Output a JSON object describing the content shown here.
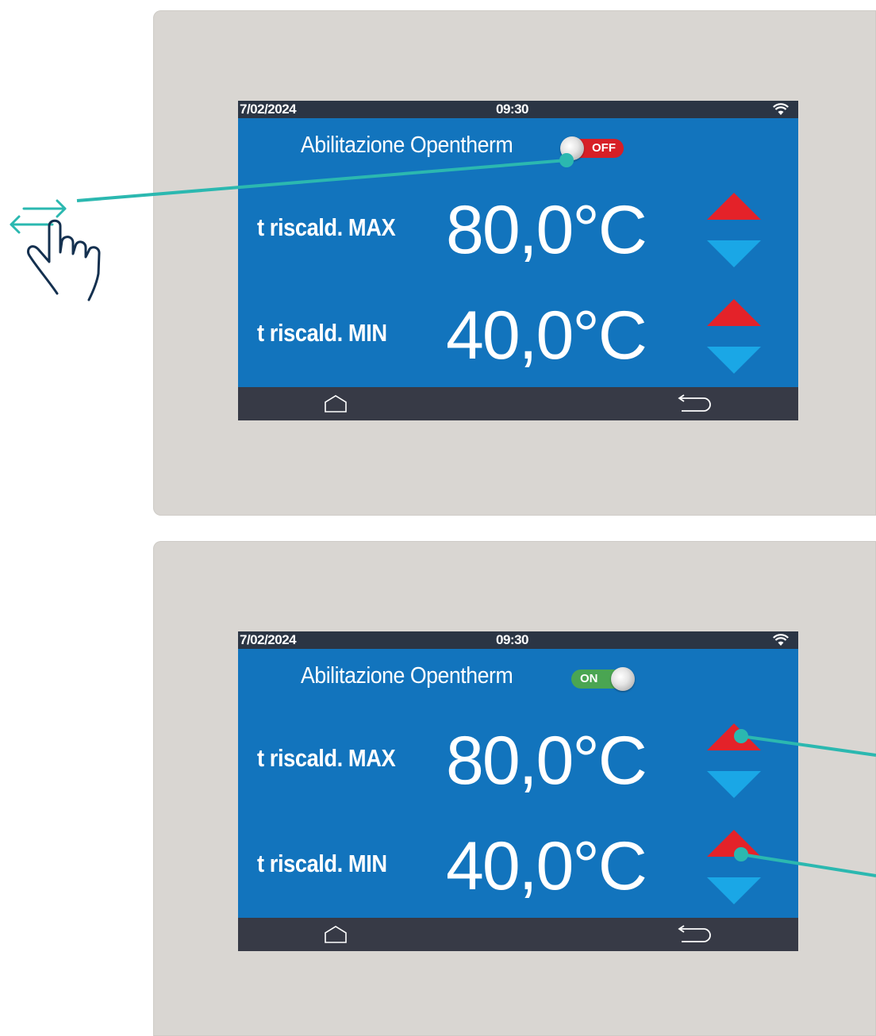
{
  "screens": [
    {
      "date": "7/02/2024",
      "time": "09:30",
      "opentherm_label": "Abilitazione Opentherm",
      "toggle_label": "OFF",
      "rows": [
        {
          "label": "t riscald. MAX",
          "value": "80,0°C"
        },
        {
          "label": "t riscald. MIN",
          "value": "40,0°C"
        }
      ]
    },
    {
      "date": "7/02/2024",
      "time": "09:30",
      "opentherm_label": "Abilitazione Opentherm",
      "toggle_label": "ON",
      "rows": [
        {
          "label": "t riscald. MAX",
          "value": "80,0°C"
        },
        {
          "label": "t riscald. MIN",
          "value": "40,0°C"
        }
      ]
    }
  ],
  "colors": {
    "screen_bg": "#1274bd",
    "status_bar": "#2b3544",
    "nav_bar": "#373a46",
    "up_arrow": "#e42229",
    "down_arrow": "#1aa7e6",
    "toggle_off": "#d71f26",
    "toggle_on": "#4aa552",
    "callout": "#2bb8b0",
    "hand_icon": "#14304f"
  },
  "icons": [
    "wifi-icon",
    "home-icon",
    "back-icon",
    "swipe-hand-icon",
    "increase-arrow-icon",
    "decrease-arrow-icon"
  ]
}
